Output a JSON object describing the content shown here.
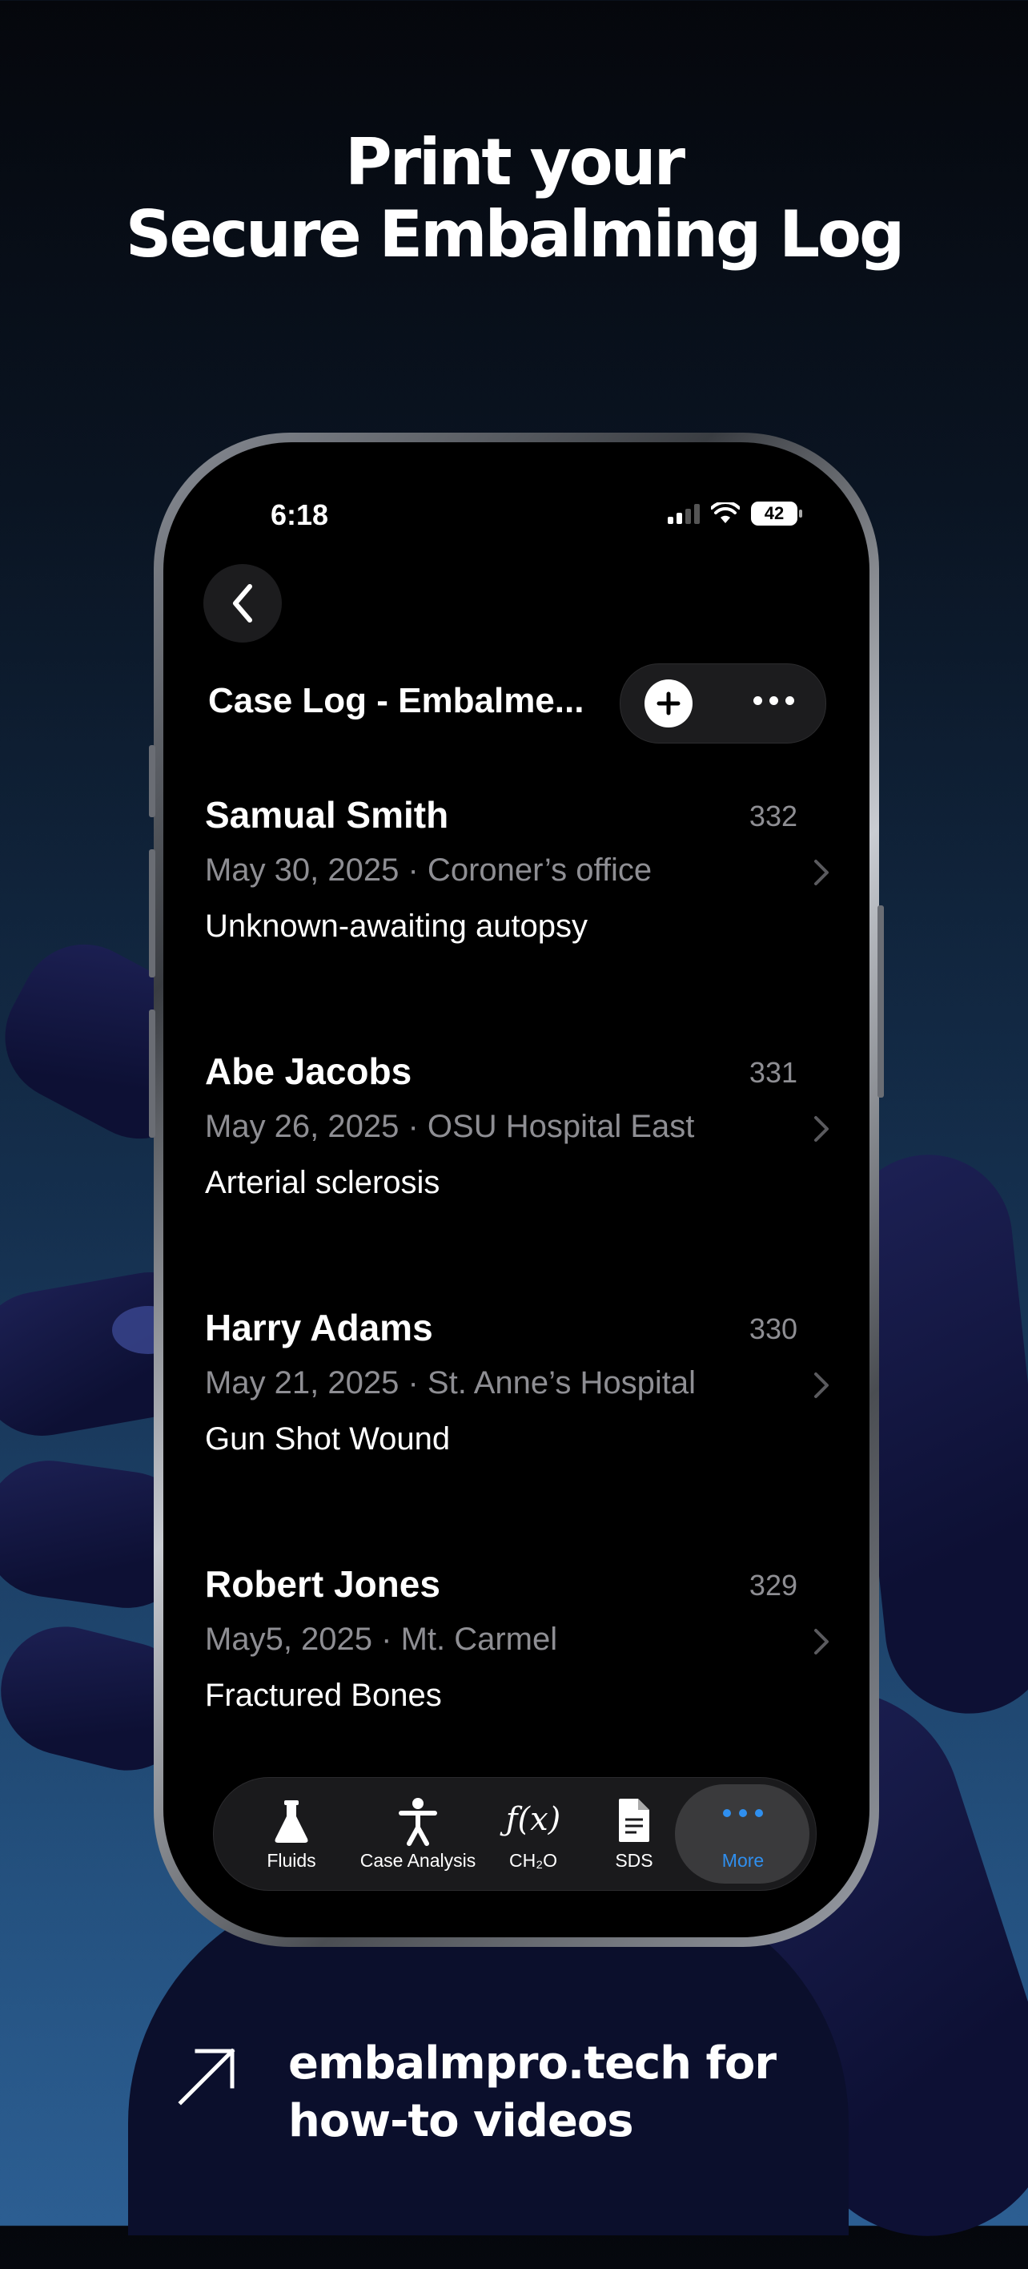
{
  "headline": {
    "line1": "Print your",
    "line2": "Secure Embalming Log"
  },
  "status_bar": {
    "time": "6:18",
    "battery": "42"
  },
  "nav": {
    "title": "Case Log - Embalme..."
  },
  "cases": [
    {
      "name": "Samual Smith",
      "number": "332",
      "meta": "May 30, 2025 · Coroner’s office",
      "cause": "Unknown-awaiting autopsy"
    },
    {
      "name": "Abe Jacobs",
      "number": "331",
      "meta": "May 26, 2025 · OSU Hospital East",
      "cause": "Arterial sclerosis"
    },
    {
      "name": "Harry Adams",
      "number": "330",
      "meta": "May 21, 2025 · St. Anne’s Hospital",
      "cause": "Gun Shot Wound"
    },
    {
      "name": "Robert Jones",
      "number": "329",
      "meta": "May5, 2025 · Mt. Carmel",
      "cause": "Fractured Bones"
    }
  ],
  "tabs": [
    {
      "label": "Fluids",
      "icon": "flask-icon"
    },
    {
      "label": "Case Analysis",
      "icon": "person-icon"
    },
    {
      "label": "CH₂O",
      "icon": "function-icon",
      "glyph": "ƒ(x)"
    },
    {
      "label": "SDS",
      "icon": "document-icon"
    },
    {
      "label": "More",
      "icon": "ellipsis-icon",
      "active": true
    }
  ],
  "footer": {
    "line1": "embalmpro.tech for",
    "line2": "how-to videos"
  },
  "colors": {
    "accent": "#2f8fef",
    "secondary_text": "#8e8e93",
    "screen_bg": "#000000"
  }
}
